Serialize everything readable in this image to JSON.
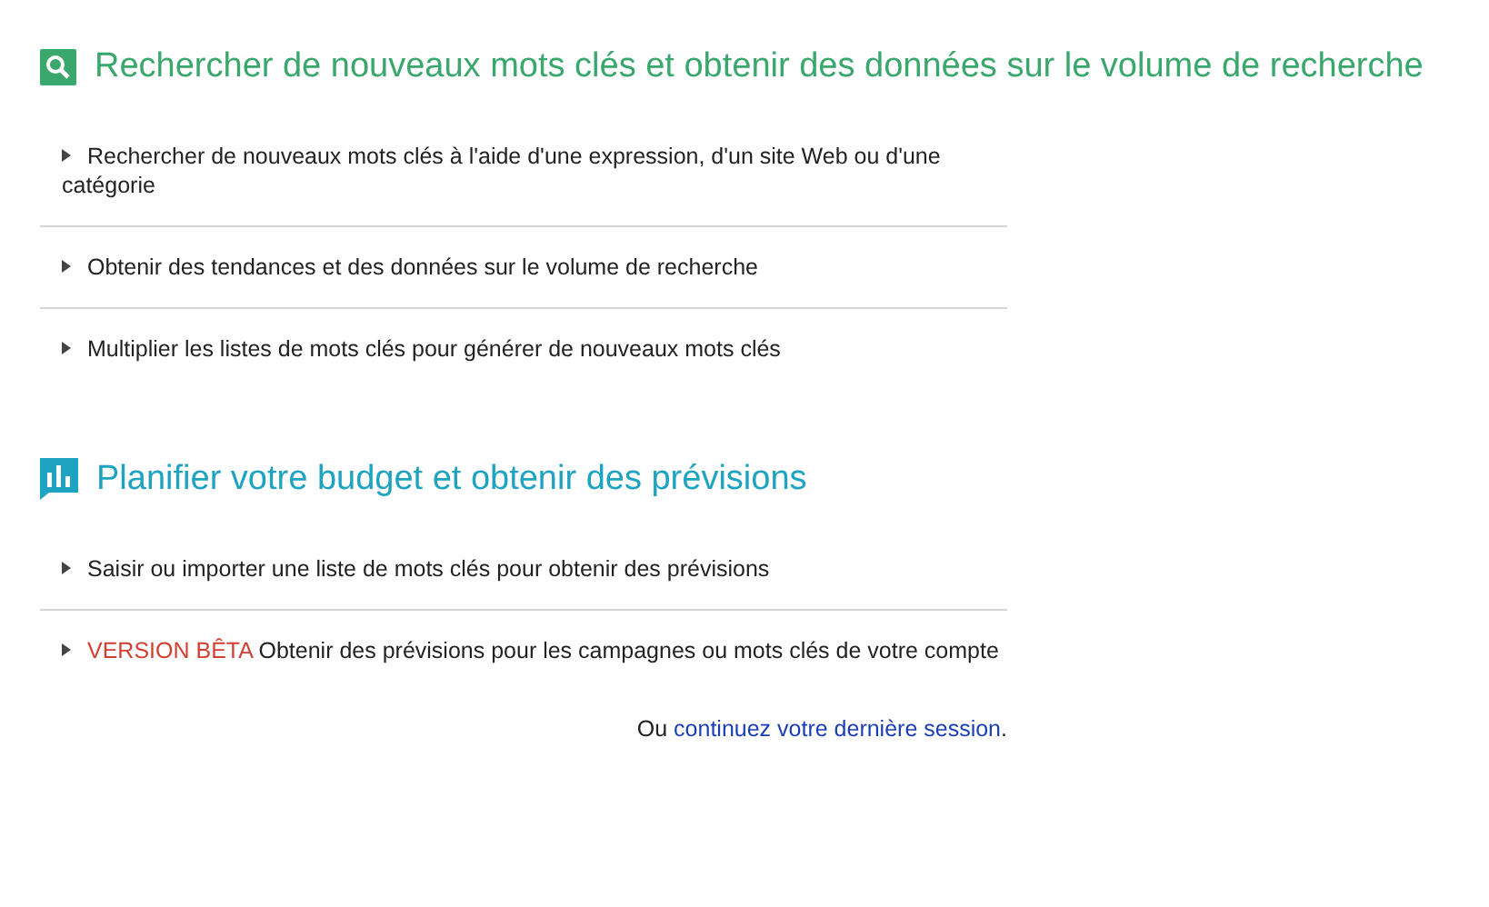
{
  "sections": [
    {
      "kind": "search",
      "title": "Rechercher de nouveaux mots clés et obtenir des données sur le volume de recherche",
      "items": [
        {
          "text": "Rechercher de nouveaux mots clés à l'aide d'une expression, d'un site Web ou d'une catégorie"
        },
        {
          "text": "Obtenir des tendances et des données sur le volume de recherche"
        },
        {
          "text": "Multiplier les listes de mots clés pour générer de nouveaux mots clés"
        }
      ]
    },
    {
      "kind": "plan",
      "title": "Planifier votre budget et obtenir des prévisions",
      "items": [
        {
          "text": "Saisir ou importer une liste de mots clés pour obtenir des prévisions"
        },
        {
          "badge": "VERSION BÊTA",
          "text": "Obtenir des prévisions pour les campagnes ou mots clés de votre compte"
        }
      ]
    }
  ],
  "footer": {
    "prefix": "Ou",
    "link": "continuez votre dernière session",
    "suffix": "."
  }
}
